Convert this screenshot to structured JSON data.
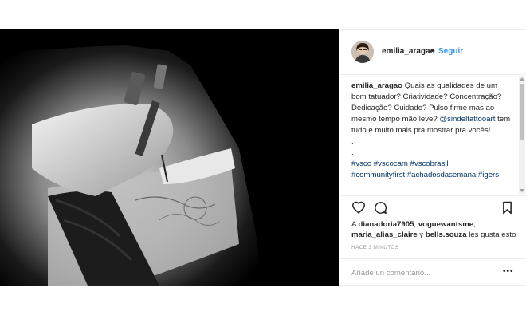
{
  "post": {
    "author": "emilia_aragao",
    "separator": "•",
    "follow_label": "Seguir",
    "caption": {
      "user": "emilia_aragao",
      "text_before_mention": "Quais as qualidades de um bom tatuador? Criatividade? Concentração? Dedicação? Cuidado? Pulso firme mas ao mesmo tempo mão leve?",
      "mention": "@sindeltattooart",
      "text_after_mention": "tem tudo e muito mais pra mostrar pra vocês!",
      "dots": [
        ".",
        "."
      ],
      "hashtags_line1": "#vsco #vscocam #vscobrasil",
      "hashtags_line2": "#communityfirst #achadosdasemana #igers"
    },
    "likes": {
      "prefix": "A",
      "user1": "dianadoria7905",
      "sep1": ",",
      "user2": "voguewantsme",
      "sep2": ",",
      "user3": "maria_alias_claire",
      "conj": "y",
      "user4": "bells.souza",
      "suffix": "les gusta esto"
    },
    "timestamp": "HACE 3 MINUTOS",
    "comment_placeholder": "Añade un comentario...",
    "more_label": "•••"
  },
  "icons": {
    "like": "heart-icon",
    "comment": "comment-icon",
    "save": "bookmark-icon"
  },
  "colors": {
    "link": "#3897f0",
    "hashtag": "#003569"
  }
}
